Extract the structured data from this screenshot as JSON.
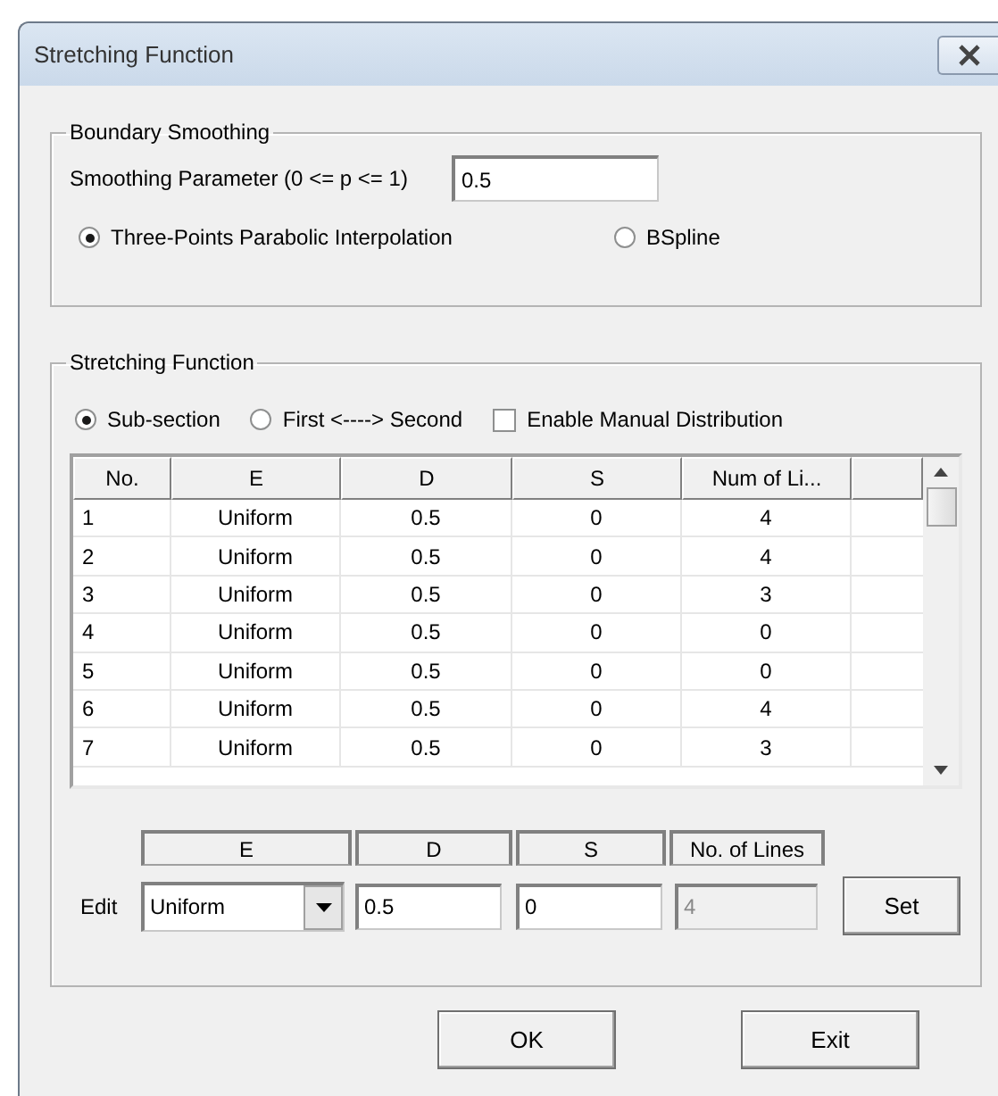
{
  "window": {
    "title": "Stretching Function"
  },
  "boundary_smoothing": {
    "title": "Boundary Smoothing",
    "parameter_label": "Smoothing Parameter (0 <= p <= 1)",
    "parameter_value": "0.5",
    "methods": [
      {
        "label": "Three-Points Parabolic Interpolation",
        "selected": true
      },
      {
        "label": "BSpline",
        "selected": false
      }
    ]
  },
  "stretching": {
    "title": "Stretching Function",
    "modes": [
      {
        "label": "Sub-section",
        "selected": true
      },
      {
        "label": "First <----> Second",
        "selected": false
      }
    ],
    "manual_distribution": {
      "label": "Enable Manual Distribution",
      "checked": false
    },
    "table": {
      "columns": [
        "No.",
        "E",
        "D",
        "S",
        "Num of Li..."
      ],
      "rows": [
        [
          "1",
          "Uniform",
          "0.5",
          "0",
          "4"
        ],
        [
          "2",
          "Uniform",
          "0.5",
          "0",
          "4"
        ],
        [
          "3",
          "Uniform",
          "0.5",
          "0",
          "3"
        ],
        [
          "4",
          "Uniform",
          "0.5",
          "0",
          "0"
        ],
        [
          "5",
          "Uniform",
          "0.5",
          "0",
          "0"
        ],
        [
          "6",
          "Uniform",
          "0.5",
          "0",
          "4"
        ],
        [
          "7",
          "Uniform",
          "0.5",
          "0",
          "3"
        ]
      ]
    },
    "edit": {
      "label": "Edit",
      "columns": [
        "E",
        "D",
        "S",
        "No. of Lines"
      ],
      "type_value": "Uniform",
      "d_value": "0.5",
      "s_value": "0",
      "lines_value": "4",
      "lines_disabled": true,
      "set_button": "Set"
    }
  },
  "buttons": [
    "OK",
    "Exit"
  ]
}
